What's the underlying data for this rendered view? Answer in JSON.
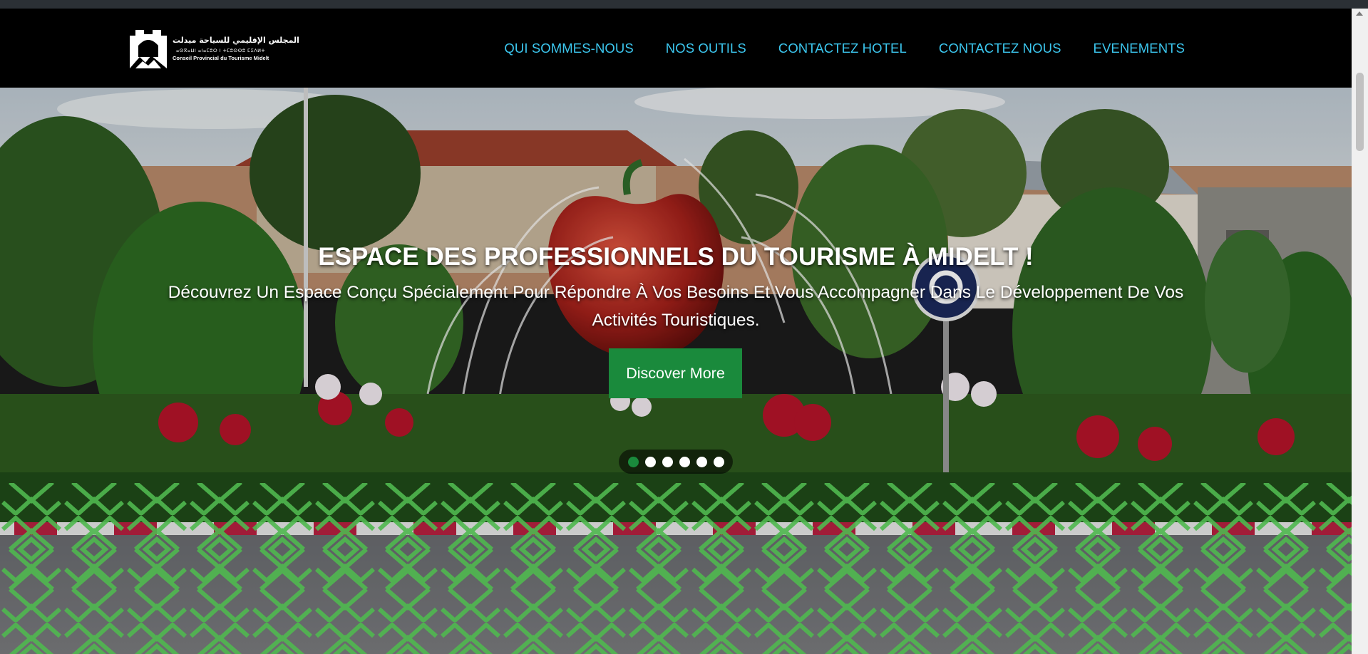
{
  "brand": {
    "arabic_name": "المجلس الإقليمي للسياحة ميدلت",
    "tifinagh_name": "ⴰⵙⴳⴰⵡⵏ ⴰⵏⴰⵎⵓⵔ ⵏ ⵜⵎⵓⵙⵙⵓ ⵎⵉⴷⵍⵜ",
    "french_name": "Conseil Provincial du Tourisme Midelt"
  },
  "nav": {
    "items": [
      {
        "label": "QUI SOMMES-NOUS"
      },
      {
        "label": "NOS OUTILS"
      },
      {
        "label": "CONTACTEZ HOTEL"
      },
      {
        "label": "CONTACTEZ NOUS"
      },
      {
        "label": "EVENEMENTS"
      }
    ]
  },
  "hero": {
    "title": "ESPACE DES PROFESSIONNELS DU TOURISME À MIDELT !",
    "subtitle": "Découvrez Un Espace Conçu Spécialement Pour Répondre À Vos Besoins Et Vous Accompagner Dans Le Développement De Vos Activités Touristiques.",
    "cta_label": "Discover More",
    "slide_count": 6,
    "active_slide": 1
  },
  "colors": {
    "nav_link": "#3cc7ef",
    "cta": "#1a8a3c",
    "pattern": "#4fb84f",
    "navbar_bg": "#000000"
  },
  "icons": {
    "logo": "kasbah-mountain-emblem",
    "roundabout_sign": "roundabout-sign-icon"
  }
}
